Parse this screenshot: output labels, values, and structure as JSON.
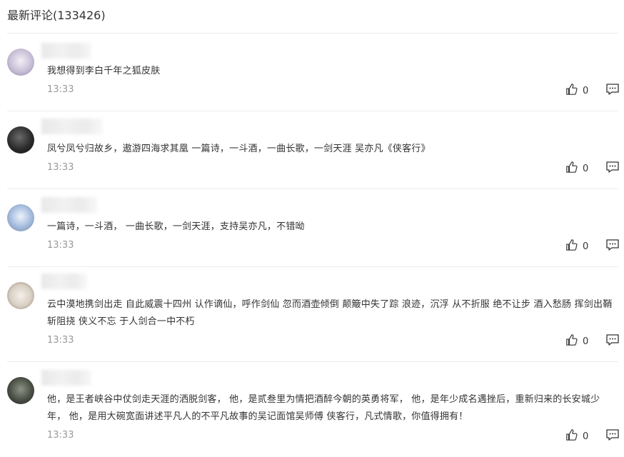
{
  "header": {
    "title": "最新评论(133426)"
  },
  "comments": [
    {
      "text": "我想得到李白千年之狐皮肤",
      "time": "13:33",
      "likes": "0",
      "avatar_color": "#b9b2c8"
    },
    {
      "text": "凤兮凤兮归故乡，遨游四海求其凰 一篇诗，一斗酒，一曲长歌，一剑天涯 吴亦凡《侠客行》",
      "time": "13:33",
      "likes": "0",
      "avatar_color": "#2b2b2b"
    },
    {
      "text": "一篇诗，一斗酒， 一曲长歌，一剑天涯，支持吴亦凡，不错呦",
      "time": "13:33",
      "likes": "0",
      "avatar_color": "#9fb6d8"
    },
    {
      "text": "云中漠地携剑出走 自此威震十四州 认作谪仙，呼作剑仙 忽而酒壶倾倒 颠簸中失了踪 浪迹，沉浮 从不折服 绝不让步 酒入愁肠 挥剑出鞘斩阻挠 侠义不忘 于人剑合一中不朽",
      "time": "13:33",
      "likes": "0",
      "avatar_color": "#d9cfc4"
    },
    {
      "text": "他，是王者峡谷中仗剑走天涯的洒脱剑客， 他，是贰叁里为情把酒醉今朝的英勇将军， 他，是年少成名遇挫后，重新归来的长安城少年， 他，是用大碗宽面讲述平凡人的不平凡故事的吴记面馆吴师傅 侠客行，凡式情歌，你值得拥有！",
      "time": "13:33",
      "likes": "0",
      "avatar_color": "#4a4f45"
    }
  ],
  "icons": {
    "like": "thumbs-up-icon",
    "reply": "comment-icon"
  }
}
